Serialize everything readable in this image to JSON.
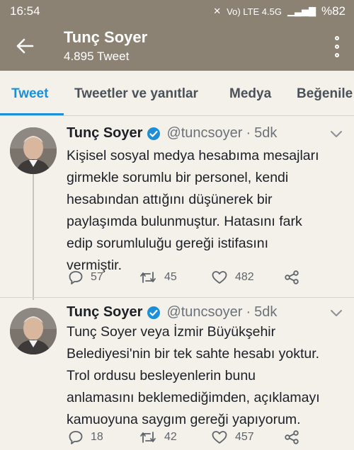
{
  "status_bar": {
    "time": "16:54",
    "network": "Vo) LTE 4.5G",
    "battery": "%82"
  },
  "header": {
    "title": "Tunç Soyer",
    "subtitle": "4.895 Tweet"
  },
  "tabs": [
    "Tweet",
    "Tweetler ve yanıtlar",
    "Medya",
    "Beğenile"
  ],
  "tweets": [
    {
      "name": "Tunç Soyer",
      "handle": "@tuncsoyer",
      "separator": "·",
      "time": "5dk",
      "lines": [
        "Kişisel sosyal medya hesabıma mesajları",
        "girmekle sorumlu bir personel, kendi",
        "hesabından attığını düşünerek bir",
        "paylaşımda bulunmuştur. Hatasını fark",
        "edip sorumluluğu gereği istifasını",
        "vermiştir."
      ],
      "replies": "57",
      "retweets": "45",
      "likes": "482"
    },
    {
      "name": "Tunç Soyer",
      "handle": "@tuncsoyer",
      "separator": "·",
      "time": "5dk",
      "lines": [
        "Tunç Soyer veya İzmir Büyükşehir",
        "Belediyesi'nin bir tek sahte hesabı yoktur.",
        "Trol ordusu besleyenlerin bunu",
        "anlamasını beklemediğimden, açıklamayı",
        "kamuoyuna saygım gereği yapıyorum."
      ],
      "replies": "18",
      "retweets": "42",
      "likes": "457"
    }
  ],
  "colors": {
    "header_bg": "#8c8273",
    "accent": "#1d8fd6",
    "background": "#f4f1ea"
  },
  "icons": [
    "back-arrow-icon",
    "more-vertical-icon",
    "verified-badge-icon",
    "chevron-down-icon",
    "reply-icon",
    "retweet-icon",
    "like-icon",
    "share-icon"
  ]
}
